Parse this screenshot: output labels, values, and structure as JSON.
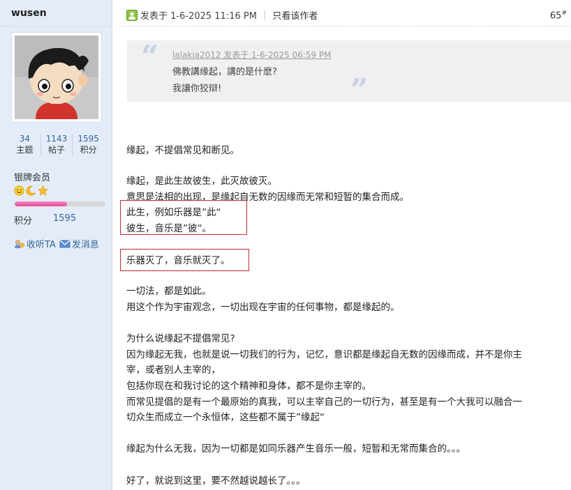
{
  "author": {
    "username": "wusen",
    "stats": [
      {
        "value": "34",
        "label": "主题"
      },
      {
        "value": "1143",
        "label": "帖子"
      },
      {
        "value": "1595",
        "label": "积分"
      }
    ],
    "rank": "银牌会员",
    "rank_icons": [
      "smiley-icon",
      "moon-icon",
      "star-icon"
    ],
    "progress_fraction": 0.58,
    "points_label": "积分",
    "points_value": "1595",
    "actions": [
      {
        "icon": "follow-icon",
        "label": "收听TA"
      },
      {
        "icon": "mail-icon",
        "label": "发消息"
      }
    ]
  },
  "post": {
    "posted_at": "发表于 1-6-2025 11:16 PM",
    "separator": "|",
    "view_author": "只看该作者",
    "floor_number": "65",
    "floor_mark": "#",
    "quote": {
      "header": "lalakia2012 发表于 1-6-2025 06:59 PM",
      "lines": [
        "佛教講缘起，講的是什麽?",
        "我讓你狡辯!"
      ]
    },
    "body_lines": [
      "缘起，不提倡常见和断见。",
      "缘起，是此生故彼生，此灭故彼灭。",
      "意思是法相的出现，是缘起自无数的因缘而无常和短暂的集合而成。",
      "此生，例如乐器是”此“",
      "彼生，音乐是”彼“。",
      "乐器灭了，音乐就灭了。",
      "一切法，都是如此。",
      "用这个作为宇宙观念，一切出现在宇宙的任何事物，都是缘起的。",
      "为什么说缘起不提倡常见?",
      "因为缘起无我，也就是说一切我们的行为，记忆，意识都是缘起自无数的因缘而成，并不是你主",
      "宰，或者别人主宰的，",
      "包括你现在和我讨论的这个精神和身体，都不是你主宰的。",
      "而常见提倡的是有一个最原始的真我，可以主宰自己的一切行为，甚至是有一个大我可以融合一",
      "切众生而成立一个永恒体，这些都不属于”缘起“",
      "缘起为什么无我，因为一切都是如同乐器产生音乐一般，短暂和无常而集合的。。。",
      "好了，就说到这里，要不然越说越长了。。。"
    ]
  },
  "colors": {
    "sidebar_bg": "#e3ecf8",
    "link": "#336699",
    "highlight_border": "#cc2b2b",
    "progress": "#e6489a"
  }
}
